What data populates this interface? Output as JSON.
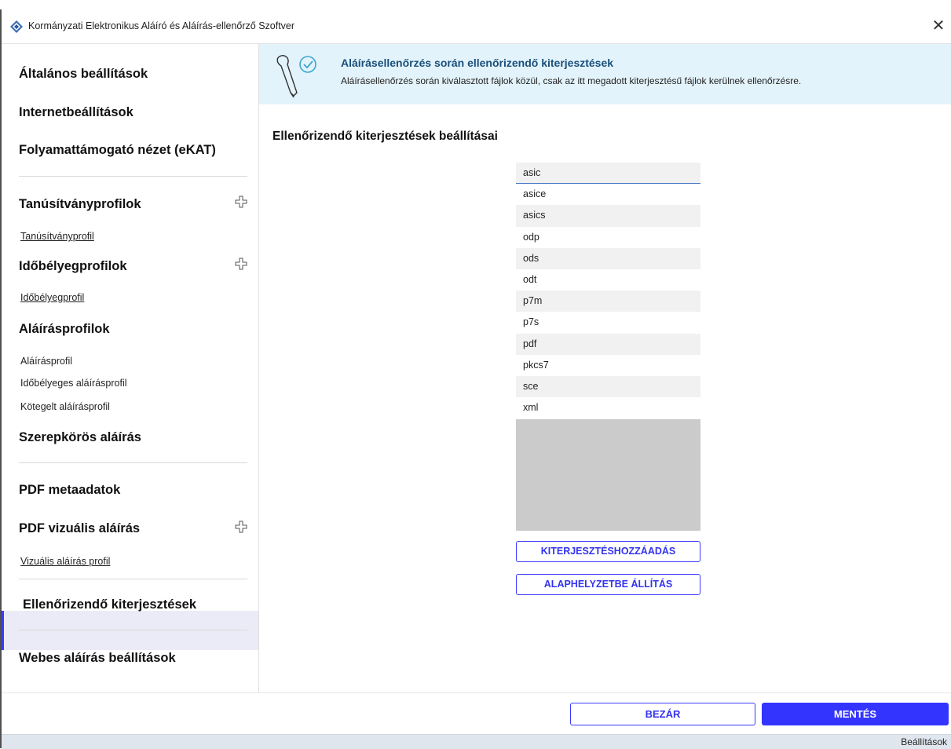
{
  "window": {
    "title": "Kormányzati Elektronikus Aláíró és Aláírás-ellenőrző Szoftver",
    "close_icon": "close-icon"
  },
  "sidebar": {
    "general": "Általános beállítások",
    "internet": "Internetbeállítások",
    "ekat": "Folyamattámogató nézet (eKAT)",
    "cert_profiles": "Tanúsítványprofilok",
    "cert_profile": "Tanúsítványprofil",
    "ts_profiles": "Időbélyegprofilok",
    "ts_profile": "Időbélyegprofil",
    "sig_profiles": "Aláírásprofilok",
    "sig_profile": "Aláírásprofil",
    "ts_sig_profile": "Időbélyeges aláírásprofil",
    "batch_sig_profile": "Kötegelt aláírásprofil",
    "role_sig": "Szerepkörös aláírás",
    "pdf_meta": "PDF metaadatok",
    "pdf_visual": "PDF vizuális aláírás",
    "visual_profile": "Vizuális aláírás profil",
    "extensions": "Ellenőrizendő kiterjesztések",
    "web_sig": "Webes aláírás beállítások",
    "accent_color": "#3a3aff"
  },
  "banner": {
    "title": "Aláírásellenőrzés során ellenőrizendő kiterjesztések",
    "description": "Aláírásellenőrzés során kiválasztott fájlok közül, csak az itt megadott kiterjesztésű fájlok kerülnek ellenőrzésre.",
    "icon": "pen-check-icon"
  },
  "main": {
    "section_title": "Ellenőrizendő kiterjesztések beállításai",
    "extensions": [
      "asic",
      "asice",
      "asics",
      "odp",
      "ods",
      "odt",
      "p7m",
      "p7s",
      "pdf",
      "pkcs7",
      "sce",
      "xml"
    ],
    "add_button": "KITERJESZTÉSHOZZÁADÁS",
    "reset_button": "ALAPHELYZETBE ÁLLÍTÁS"
  },
  "footer": {
    "close_button": "BEZÁR",
    "save_button": "MENTÉS",
    "save_color": "#3434ff"
  },
  "statusbar": {
    "text": "Beállítások"
  }
}
